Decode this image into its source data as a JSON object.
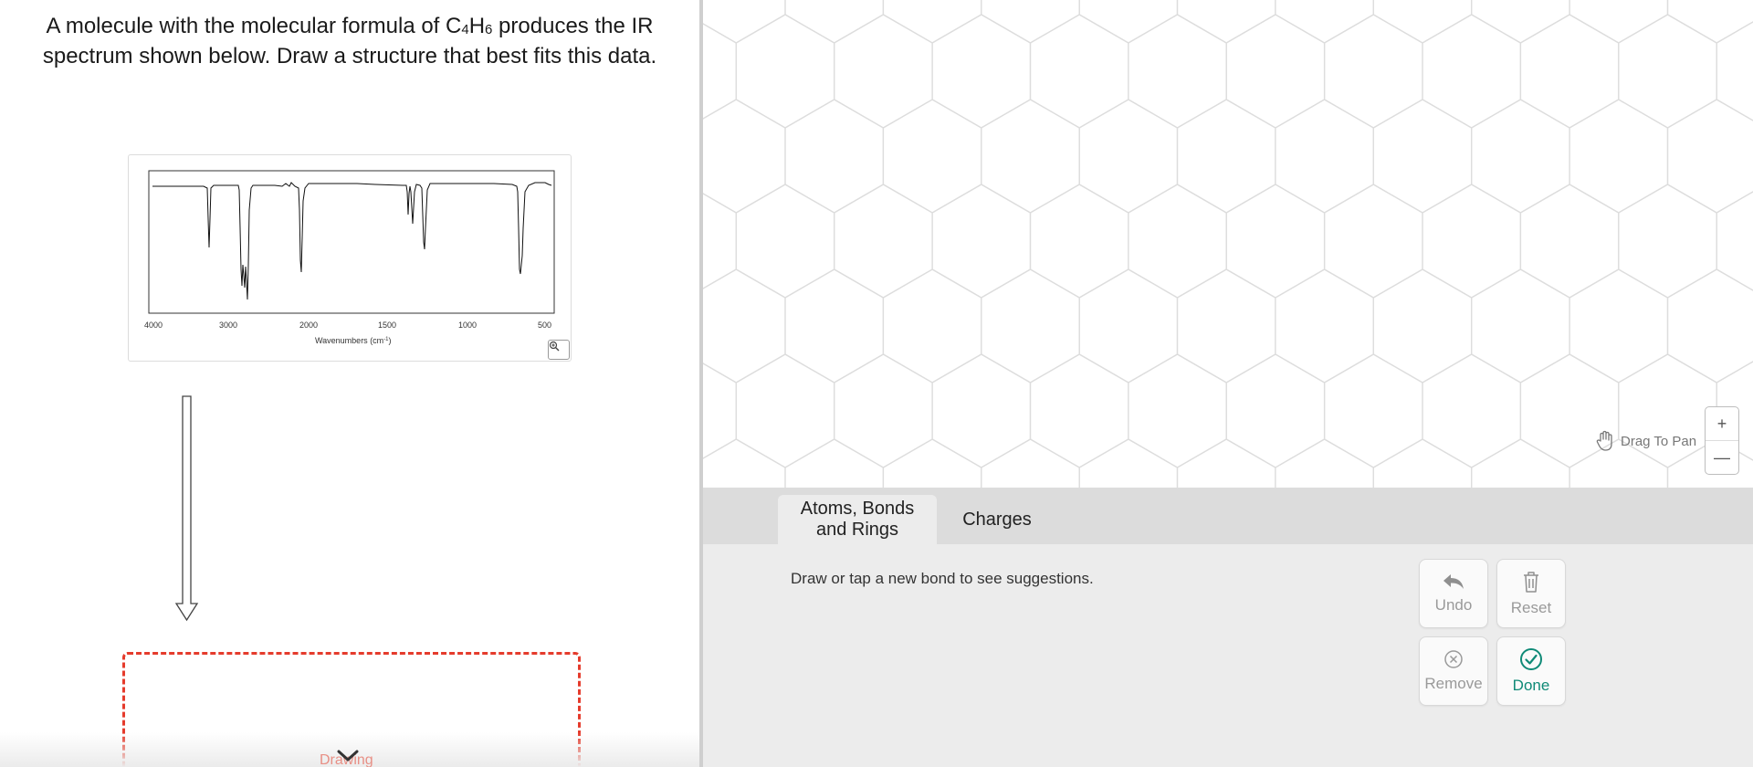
{
  "question": {
    "line1_a": "A molecule with the molecular formula of C",
    "sub1": "4",
    "line1_b": "H",
    "sub2": "6",
    "line1_c": " produces the IR",
    "line2": "spectrum shown below. Draw a structure that best fits this data."
  },
  "ir_spectrum": {
    "x_ticks": [
      "4000",
      "3000",
      "2000",
      "1500",
      "1000",
      "500"
    ],
    "xlabel": "Wavenumbers (cm",
    "xlabel_sup": "-1",
    "xlabel_end": ")"
  },
  "drawing_label": "Drawing",
  "canvas": {
    "pan_hint": "Drag To Pan",
    "zoom_in": "+",
    "zoom_out": "—"
  },
  "tabs": [
    {
      "label_line1": "Atoms, Bonds",
      "label_line2": "and Rings",
      "active": true
    },
    {
      "label": "Charges",
      "active": false
    }
  ],
  "toolbox": {
    "hint": "Draw or tap a new bond to see suggestions.",
    "buttons": {
      "undo": "Undo",
      "reset": "Reset",
      "remove": "Remove",
      "done": "Done"
    }
  },
  "colors": {
    "accent_red": "#e53b2c",
    "done_green": "#0f8a77",
    "grid_line": "#dddddd"
  },
  "icons": [
    "undo-arrow-icon",
    "trash-icon",
    "remove-circle-x-icon",
    "done-check-circle-icon",
    "hand-pan-icon",
    "magnify-plus-icon",
    "chevron-down-icon",
    "down-arrow-icon"
  ]
}
